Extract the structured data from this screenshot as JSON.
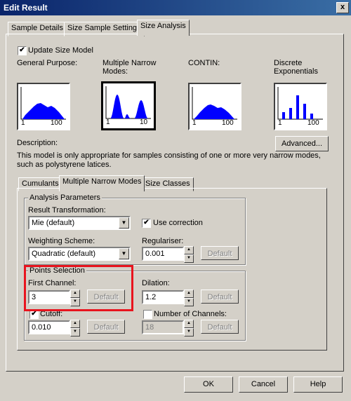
{
  "window": {
    "title": "Edit Result",
    "close": "x"
  },
  "tabs": [
    "Sample Details",
    "Size Sample Settings",
    "Size Analysis"
  ],
  "update_size_model": {
    "checked": true,
    "label": "Update Size Model"
  },
  "models": [
    {
      "label": "General Purpose:",
      "axis_min": "1",
      "axis_max": "100",
      "selected": false
    },
    {
      "label": "Multiple Narrow Modes:",
      "axis_min": "1",
      "axis_max": "10",
      "selected": true
    },
    {
      "label": "CONTIN:",
      "axis_min": "1",
      "axis_max": "100",
      "selected": false
    },
    {
      "label": "Discrete Exponentials",
      "axis_min": "1",
      "axis_max": "100",
      "selected": false
    }
  ],
  "advanced_button": "Advanced...",
  "description": {
    "label": "Description:",
    "text": "This model is only appropriate for samples consisting of one or more very narrow modes, such as polystyrene latices."
  },
  "subtabs": [
    "Cumulants",
    "Multiple Narrow Modes",
    "Size Classes"
  ],
  "analysis_parameters": {
    "group_label": "Analysis Parameters",
    "result_transformation_label": "Result Transformation:",
    "result_transformation_value": "Mie (default)",
    "use_correction": {
      "checked": true,
      "label": "Use correction"
    },
    "weighting_scheme_label": "Weighting Scheme:",
    "weighting_scheme_value": "Quadratic (default)",
    "regulariser_label": "Regulariser:",
    "regulariser_value": "0.001",
    "default_label": "Default"
  },
  "points_selection": {
    "group_label": "Points Selection",
    "first_channel_label": "First Channel:",
    "first_channel_value": "3",
    "dilation_label": "Dilation:",
    "dilation_value": "1.2",
    "cutoff": {
      "checked": true,
      "label": "Cutoff:",
      "value": "0.010"
    },
    "number_of_channels": {
      "checked": false,
      "label": "Number of Channels:",
      "value": "18"
    },
    "default_label": "Default"
  },
  "footer": {
    "ok": "OK",
    "cancel": "Cancel",
    "help": "Help"
  },
  "colors": {
    "title_bar": "#0a246a",
    "chart_fill": "#0000ff",
    "highlight_box": "#e8141e"
  }
}
